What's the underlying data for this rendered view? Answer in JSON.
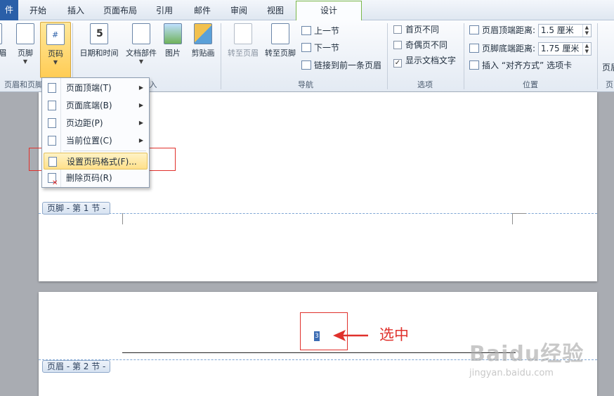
{
  "tabs": [
    "件",
    "开始",
    "插入",
    "页面布局",
    "引用",
    "邮件",
    "审阅",
    "视图",
    "设计"
  ],
  "ribbon": {
    "left_cut_labels": [
      "眉",
      "页眉和页脚"
    ],
    "buttons": {
      "footer": "页脚",
      "page_number": "页码",
      "date_time": "日期和时间",
      "quick_parts": "文档部件",
      "picture": "图片",
      "clip_art": "剪贴画",
      "goto_header": "转至页眉",
      "goto_footer": "转至页脚",
      "prev_section": "上一节",
      "next_section": "下一节",
      "link_prev": "链接到前一条页眉"
    },
    "options": {
      "first_page": {
        "label": "首页不同",
        "checked": false
      },
      "odd_even": {
        "label": "奇偶页不同",
        "checked": false
      },
      "show_text": {
        "label": "显示文档文字",
        "checked": true
      }
    },
    "position": {
      "header_label": "页眉顶端距离:",
      "header_value": "1.5 厘米",
      "footer_label": "页脚底端距离:",
      "footer_value": "1.75 厘米",
      "align_tab": "插入 “对齐方式” 选项卡"
    },
    "group_labels": {
      "insert_tail": "入",
      "navigation": "导航",
      "options": "选项",
      "position": "位置"
    },
    "right_cut": "页眉",
    "right_cut2": "页"
  },
  "menu": {
    "items": [
      {
        "label": "页面顶端(T)",
        "submenu": true
      },
      {
        "label": "页面底端(B)",
        "submenu": true
      },
      {
        "label": "页边距(P)",
        "submenu": true
      },
      {
        "label": "当前位置(C)",
        "submenu": true
      },
      {
        "label": "设置页码格式(F)...",
        "submenu": false
      },
      {
        "label": "删除页码(R)",
        "submenu": false
      }
    ]
  },
  "document": {
    "footer_tag": "页脚 - 第 1 节 -",
    "header_tag": "页眉 - 第 2 节 -",
    "page_number_text": "3"
  },
  "annotation": {
    "text": "选中",
    "color": "#e0312c"
  },
  "watermark": {
    "logo": "Baidu经验",
    "url": "jingyan.baidu.com"
  }
}
